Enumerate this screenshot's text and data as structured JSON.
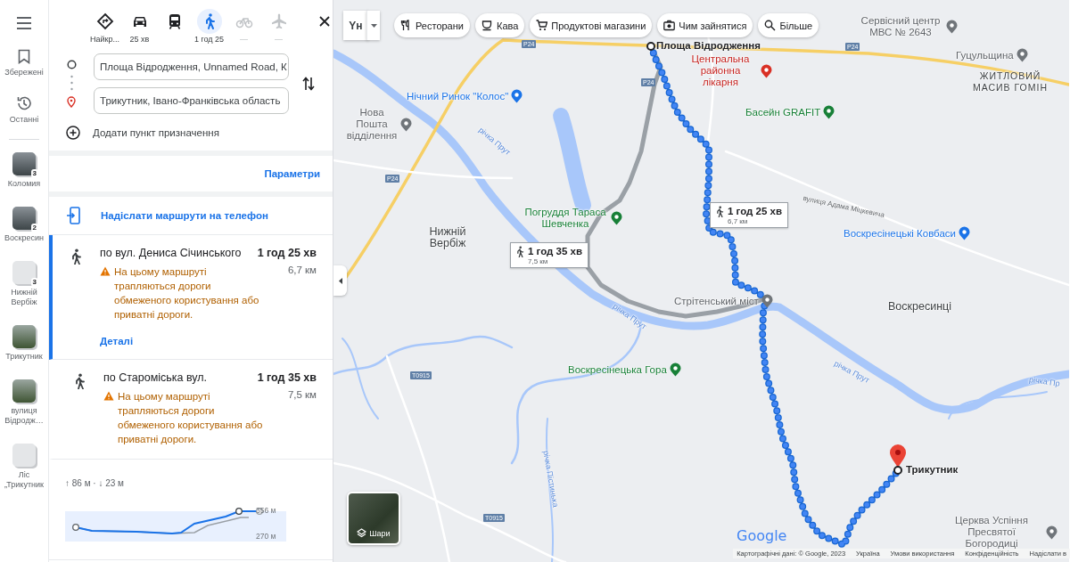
{
  "sidebar": {
    "items": [
      {
        "kind": "saved",
        "label": "Збережені"
      },
      {
        "kind": "recent",
        "label": "Останні"
      }
    ],
    "recent_places": [
      {
        "kind": "photo",
        "label": "Коломия",
        "badge": "3"
      },
      {
        "kind": "photo",
        "label": "Воскресин",
        "badge": "2"
      },
      {
        "kind": "generic",
        "label": "Нижній Вербіж",
        "badge": "3"
      },
      {
        "kind": "photo",
        "label": "Трикутник"
      },
      {
        "kind": "photo",
        "label": "вулиця Відродж…"
      },
      {
        "kind": "generic",
        "label": "Ліс „Трикутник"
      }
    ]
  },
  "directions": {
    "modes": [
      {
        "kind": "best",
        "label": "Найкр...",
        "selected": false,
        "disabled": false
      },
      {
        "kind": "car",
        "label": "25 хв",
        "selected": false,
        "disabled": false
      },
      {
        "kind": "transit",
        "selected": false,
        "disabled": false
      },
      {
        "kind": "walk",
        "label": "1 год 25",
        "selected": true,
        "disabled": false
      },
      {
        "kind": "bike",
        "label": "—",
        "selected": false,
        "disabled": true
      },
      {
        "kind": "flight",
        "label": "—",
        "selected": false,
        "disabled": true
      }
    ],
    "origin": "Площа Відродження, Unnamed Road, К",
    "destination": "Трикутник, Івано-Франківська область",
    "add_destination": "Додати пункт призначення",
    "options_link": "Параметри",
    "send_to_phone": "Надіслати маршрути на телефон",
    "routes": [
      {
        "via": "по вул. Дениса Січинського",
        "duration": "1 год 25 хв",
        "distance": "6,7 км",
        "warning": "На цьому маршруті трапляються дороги обмеженого користування або приватні дороги.",
        "details_link": "Деталі",
        "selected": true
      },
      {
        "via": "по Староміська вул.",
        "duration": "1 год 35 хв",
        "distance": "7,5 км",
        "warning": "На цьому маршруті трапляються дороги обмеженого користування або приватні дороги.",
        "selected": false
      }
    ],
    "elevation": {
      "summary": "↑ 86 м · ↓ 23 м",
      "max_label": "356 м",
      "min_label": "270 м"
    }
  },
  "map": {
    "input_tool": "Yн",
    "chips": [
      {
        "kind": "restaurant",
        "label": "Ресторани"
      },
      {
        "kind": "coffee",
        "label": "Кава"
      },
      {
        "kind": "grocery",
        "label": "Продуктові магазини"
      },
      {
        "kind": "camera",
        "label": "Чим зайнятися"
      },
      {
        "kind": "search",
        "label": "Більше"
      }
    ],
    "labels": [
      {
        "kind": "endpoint",
        "text": "Площа Відродження"
      },
      {
        "kind": "hospital",
        "text": "Центральна районна лікарня"
      },
      {
        "kind": "poi",
        "text": "Сервісний центр МВС № 2643"
      },
      {
        "kind": "poi",
        "text": "Гуцульщина"
      },
      {
        "kind": "district",
        "text": "ЖИТЛОВИЙ МАСИВ ГОМІН"
      },
      {
        "kind": "shop",
        "text": "Нічний Ринок \"Колос\""
      },
      {
        "kind": "poi",
        "text": "Нова Пошта відділення"
      },
      {
        "kind": "park",
        "text": "Басейн GRAFIT"
      },
      {
        "kind": "river",
        "text": "річка Прут"
      },
      {
        "kind": "street",
        "text": "вулиця Адама Міцкевича"
      },
      {
        "kind": "park",
        "text": "Погруддя Тараса Шевченка"
      },
      {
        "kind": "town",
        "text": "Нижній Вербіж"
      },
      {
        "kind": "shop",
        "text": "Воскресінецькі Ковбаси"
      },
      {
        "kind": "poi",
        "text": "Стрітенський міст"
      },
      {
        "kind": "town",
        "text": "Воскресинці"
      },
      {
        "kind": "river",
        "text": "річка Прут"
      },
      {
        "kind": "park",
        "text": "Воскресінецька Гора"
      },
      {
        "kind": "river",
        "text": "річка Прут"
      },
      {
        "kind": "river",
        "text": "річка Пр"
      },
      {
        "kind": "river",
        "text": "річка Пістинька"
      },
      {
        "kind": "endpoint",
        "text": "Трикутник"
      },
      {
        "kind": "church",
        "text": "Церква Успіння Пресвятої Богородиці"
      }
    ],
    "road_signs": [
      "P24",
      "P24",
      "P24",
      "P24",
      "T0915",
      "T0915"
    ],
    "route_callouts": [
      {
        "duration": "1 год 25 хв",
        "distance": "6,7 км"
      },
      {
        "duration": "1 год 35 хв",
        "distance": "7,5 км"
      }
    ],
    "layers_button": "Шари",
    "logo": "Google",
    "attribution": [
      "Картографічні дані: © Google, 2023",
      "Україна",
      "Умови використання",
      "Конфіденційність",
      "Надіслати в"
    ]
  }
}
